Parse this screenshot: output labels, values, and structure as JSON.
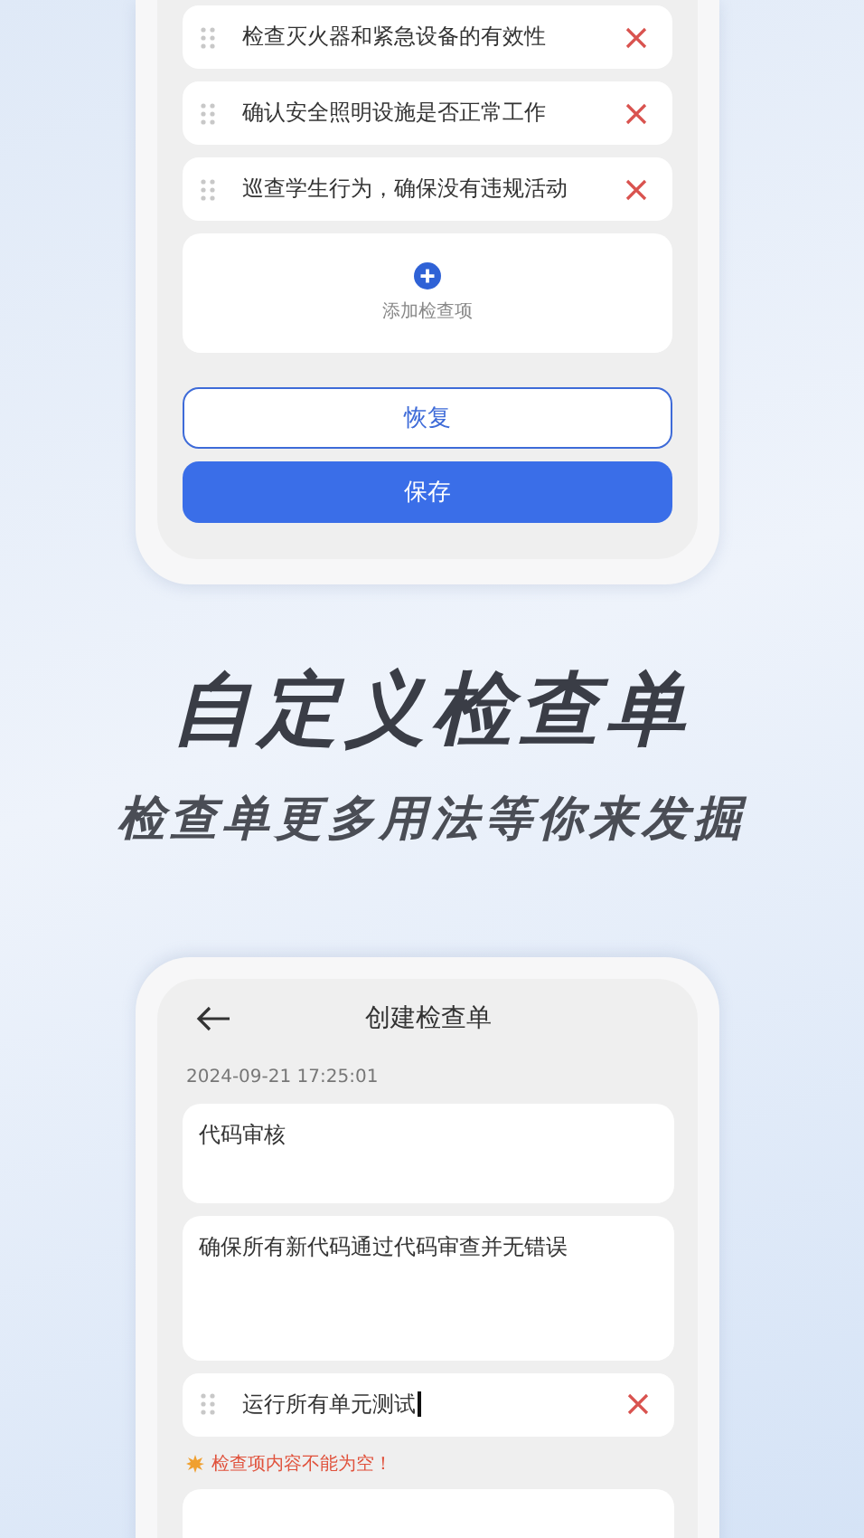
{
  "top_screen": {
    "items": [
      {
        "text": "检查灭火器和紧急设备的有效性"
      },
      {
        "text": "确认安全照明设施是否正常工作"
      },
      {
        "text": "巡查学生行为，确保没有违规活动"
      }
    ],
    "add_item": {
      "label": "添加检查项"
    },
    "buttons": [
      {
        "label": "恢复",
        "kind": "outline"
      },
      {
        "label": "保存",
        "kind": "primary"
      }
    ]
  },
  "headline": "自定义检查单",
  "subheadline": "检查单更多用法等你来发掘",
  "bottom_screen": {
    "title": "创建检查单",
    "timestamp": "2024-09-21 17:25:01",
    "name_field": {
      "value": "代码审核"
    },
    "description_field": {
      "value": "确保所有新代码通过代码审查并无错误"
    },
    "items": [
      {
        "text": "运行所有单元测试",
        "focused": true
      }
    ],
    "error": "检查项内容不能为空！"
  }
}
